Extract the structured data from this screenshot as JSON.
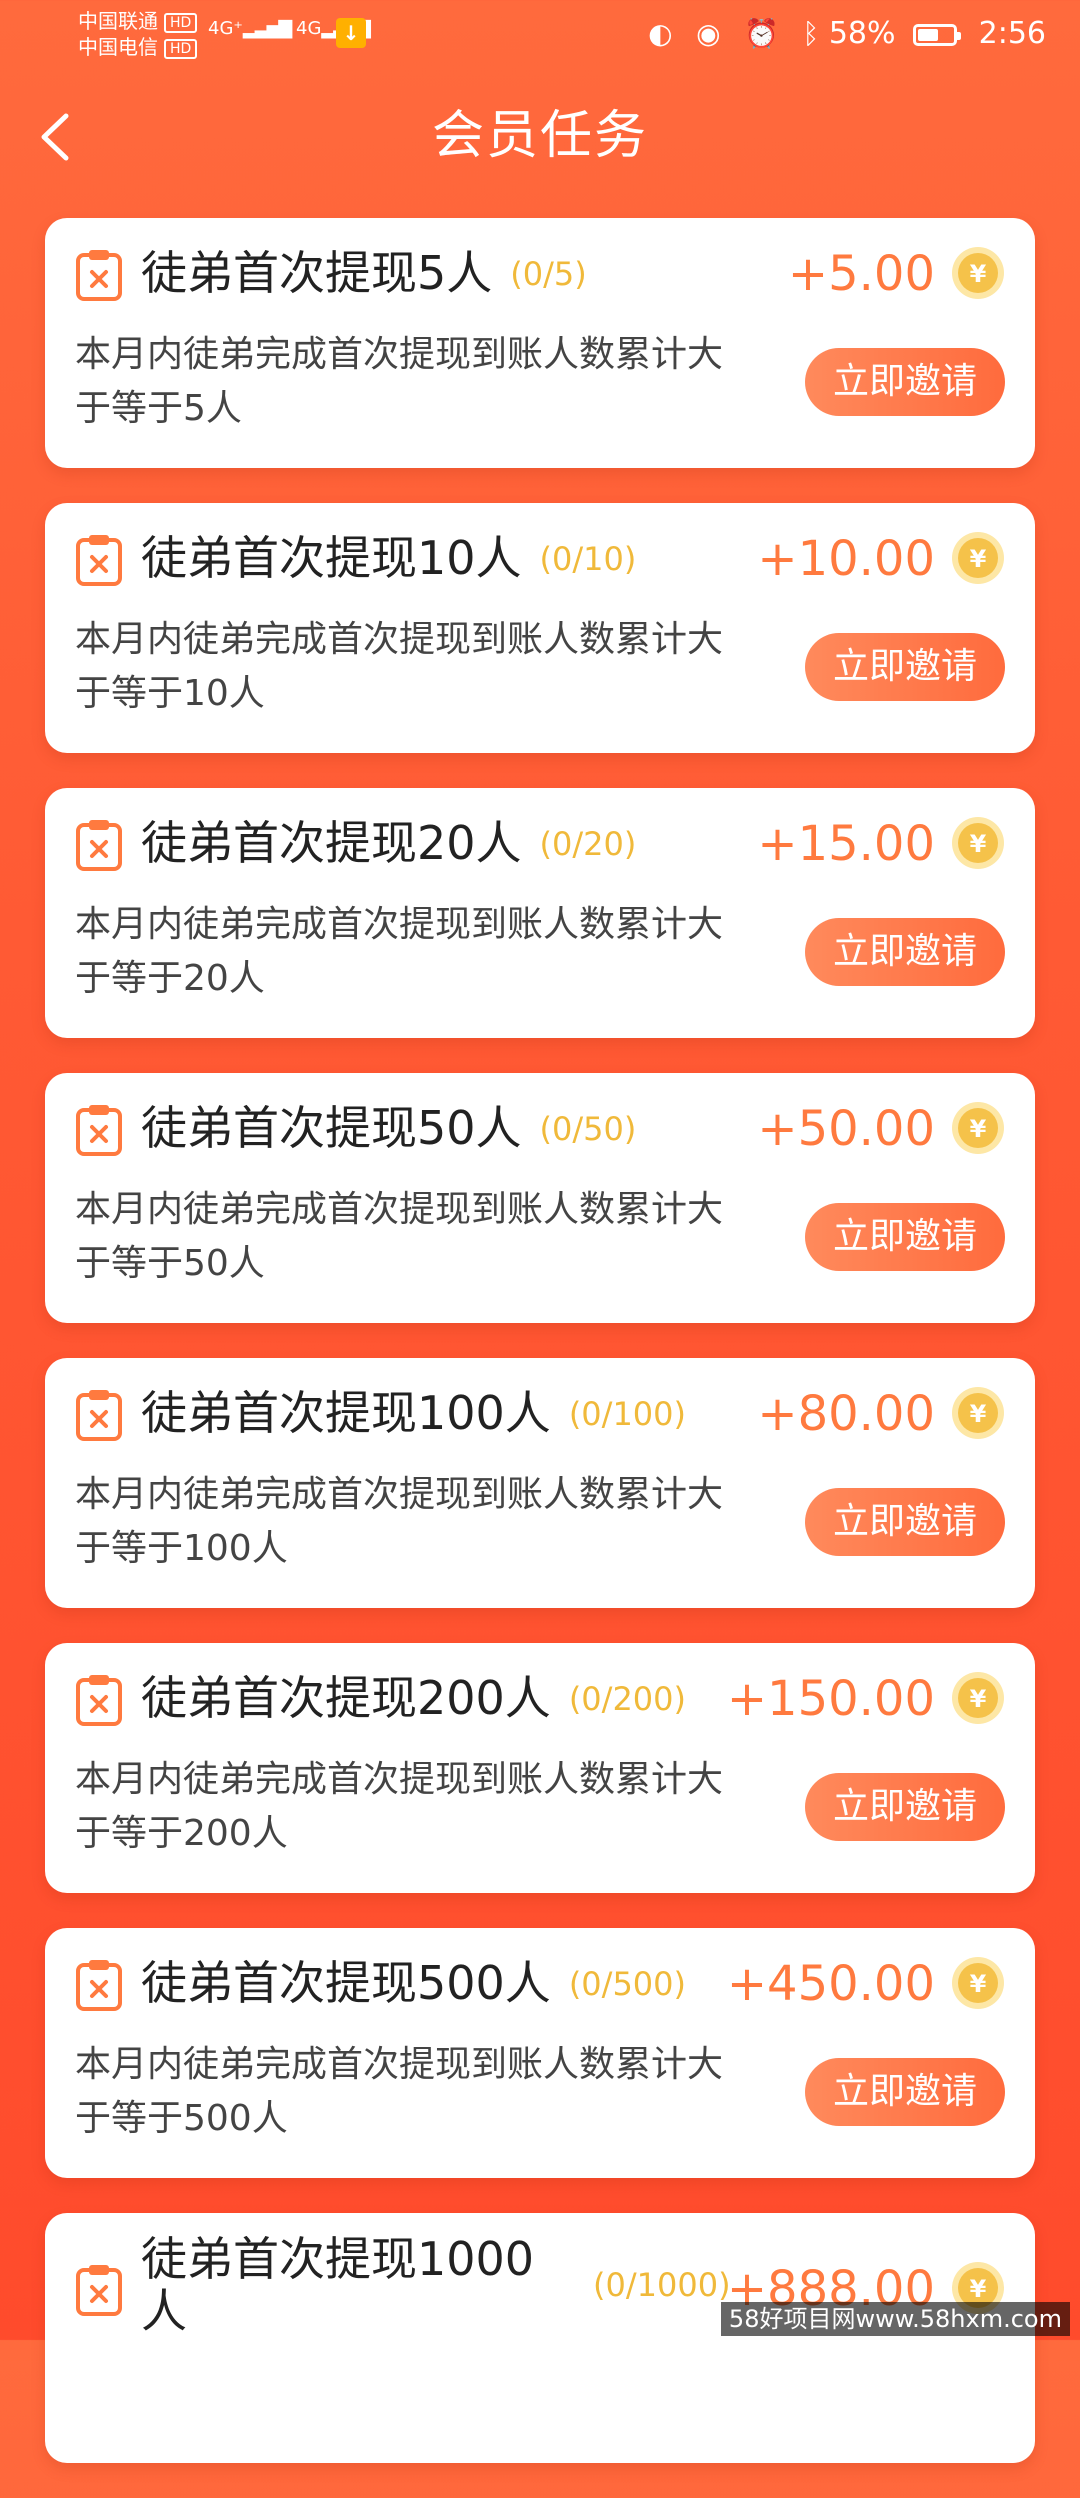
{
  "status_bar": {
    "carrier_1": "中国联通",
    "carrier_2": "中国电信",
    "hd_label": "HD",
    "network_1": "4G⁺",
    "network_2": "4G",
    "battery_percent": "58%",
    "battery_level": 0.58,
    "time": "2:56"
  },
  "header": {
    "title": "会员任务",
    "back_icon": "chevron-left-icon"
  },
  "tasks": [
    {
      "title": "徒弟首次提现5人",
      "progress": "(0/5)",
      "reward": "+5.00",
      "desc": "本月内徒弟完成首次提现到账人数累计大于等于5人",
      "button": "立即邀请"
    },
    {
      "title": "徒弟首次提现10人",
      "progress": "(0/10)",
      "reward": "+10.00",
      "desc": "本月内徒弟完成首次提现到账人数累计大于等于10人",
      "button": "立即邀请"
    },
    {
      "title": "徒弟首次提现20人",
      "progress": "(0/20)",
      "reward": "+15.00",
      "desc": "本月内徒弟完成首次提现到账人数累计大于等于20人",
      "button": "立即邀请"
    },
    {
      "title": "徒弟首次提现50人",
      "progress": "(0/50)",
      "reward": "+50.00",
      "desc": "本月内徒弟完成首次提现到账人数累计大于等于50人",
      "button": "立即邀请"
    },
    {
      "title": "徒弟首次提现100人",
      "progress": "(0/100)",
      "reward": "+80.00",
      "desc": "本月内徒弟完成首次提现到账人数累计大于等于100人",
      "button": "立即邀请"
    },
    {
      "title": "徒弟首次提现200人",
      "progress": "(0/200)",
      "reward": "+150.00",
      "desc": "本月内徒弟完成首次提现到账人数累计大于等于200人",
      "button": "立即邀请"
    },
    {
      "title": "徒弟首次提现500人",
      "progress": "(0/500)",
      "reward": "+450.00",
      "desc": "本月内徒弟完成首次提现到账人数累计大于等于500人",
      "button": "立即邀请"
    }
  ],
  "last_task": {
    "title_line1": "徒弟首次提现1000",
    "title_line2": "人",
    "progress": "(0/1000)",
    "reward": "+888.00"
  },
  "colors": {
    "accent": "#ff5a34",
    "reward_text": "#ff7a3f",
    "progress_text": "#f0b93a",
    "coin": "#f5c24a"
  },
  "watermark": "58好项目网www.58hxm.com"
}
